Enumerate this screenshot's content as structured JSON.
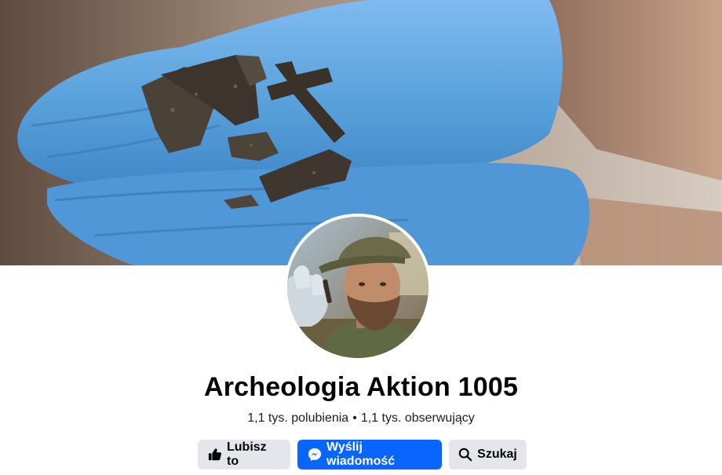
{
  "page": {
    "name": "Archeologia Aktion 1005"
  },
  "stats": {
    "likes": "1,1 tys. polubienia",
    "separator": "•",
    "followers": "1,1 tys. obserwujący"
  },
  "actions": {
    "like_label": "Lubisz to",
    "message_label": "Wyślij wiadomość",
    "search_label": "Szukaj"
  },
  "icons": {
    "like": "thumbs-up-icon",
    "message": "messenger-icon",
    "search": "search-icon"
  },
  "colors": {
    "primary_button": "#0866ff",
    "secondary_button": "#e4e6eb",
    "text": "#050505",
    "glove": "#5aa2dc"
  }
}
